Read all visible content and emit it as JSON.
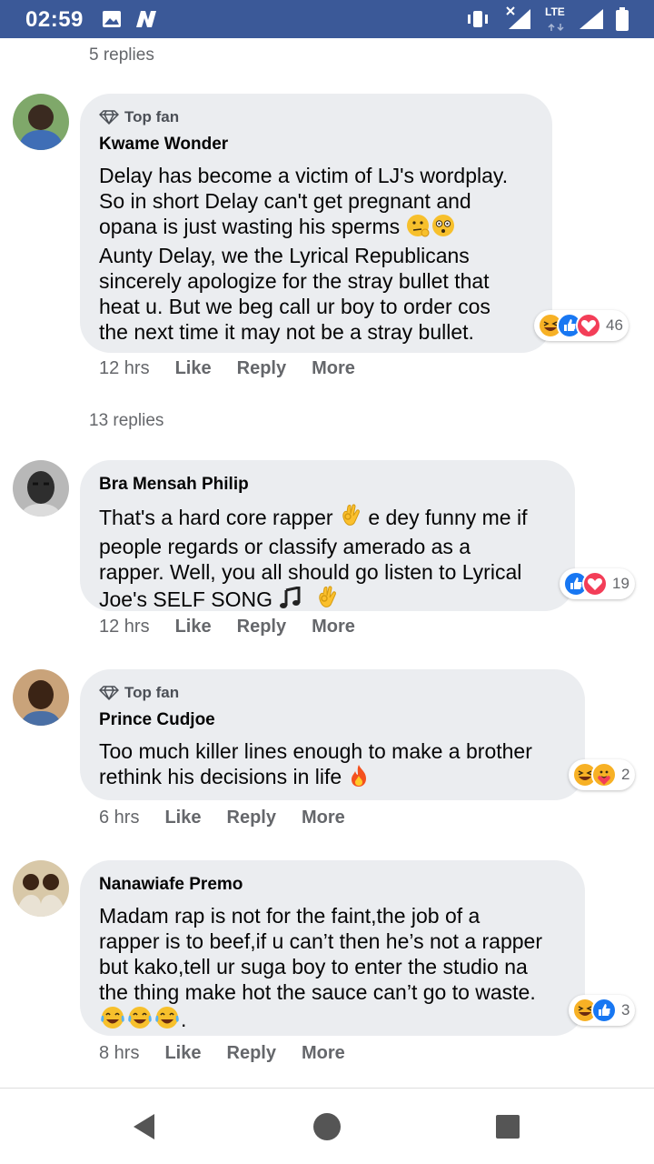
{
  "status_bar": {
    "time": "02:59",
    "network_label": "LTE"
  },
  "replies_top": "5 replies",
  "replies_mid": "13 replies",
  "comments": [
    {
      "top_fan_label": "Top fan",
      "author": "Kwame Wonder",
      "lines": [
        "Delay has become a victim of LJ's wordplay.",
        "So in short Delay can't get pregnant and",
        "opana is just wasting his sperms",
        "Aunty Delay, we the Lyrical Republicans",
        "sincerely apologize for the stray bullet that",
        "heat u. But we beg call ur boy to order cos",
        "the next time it may not be a stray bullet."
      ],
      "reaction_count": "46",
      "time": "12 hrs",
      "like": "Like",
      "reply": "Reply",
      "more": "More"
    },
    {
      "author": "Bra Mensah Philip",
      "lines": [
        "That's a hard core rapper",
        "e dey funny me if",
        "people regards or classify amerado as a",
        "rapper. Well, you all should go listen to Lyrical",
        "Joe's SELF SONG"
      ],
      "reaction_count": "19",
      "time": "12 hrs",
      "like": "Like",
      "reply": "Reply",
      "more": "More"
    },
    {
      "top_fan_label": "Top fan",
      "author": "Prince Cudjoe",
      "lines": [
        "Too much killer lines enough to make a brother",
        "rethink his decisions in life"
      ],
      "reaction_count": "2",
      "time": "6 hrs",
      "like": "Like",
      "reply": "Reply",
      "more": "More"
    },
    {
      "author": "Nanawiafe Premo",
      "lines": [
        "Madam rap is not for the faint,the job of a",
        "rapper is to beef,if u can’t then he’s not a rapper",
        "but kako,tell ur suga boy to enter the studio na",
        "the thing make hot the sauce can’t go to waste.",
        "."
      ],
      "reaction_count": "3",
      "time": "8 hrs",
      "like": "Like",
      "reply": "Reply",
      "more": "More"
    }
  ],
  "colors": {
    "status_bar": "#3b5998",
    "bubble": "#ebedf0",
    "meta_text": "#65676b",
    "like_blue": "#1877f2",
    "love_red": "#f33e58",
    "haha_yellow": "#f7b125"
  }
}
